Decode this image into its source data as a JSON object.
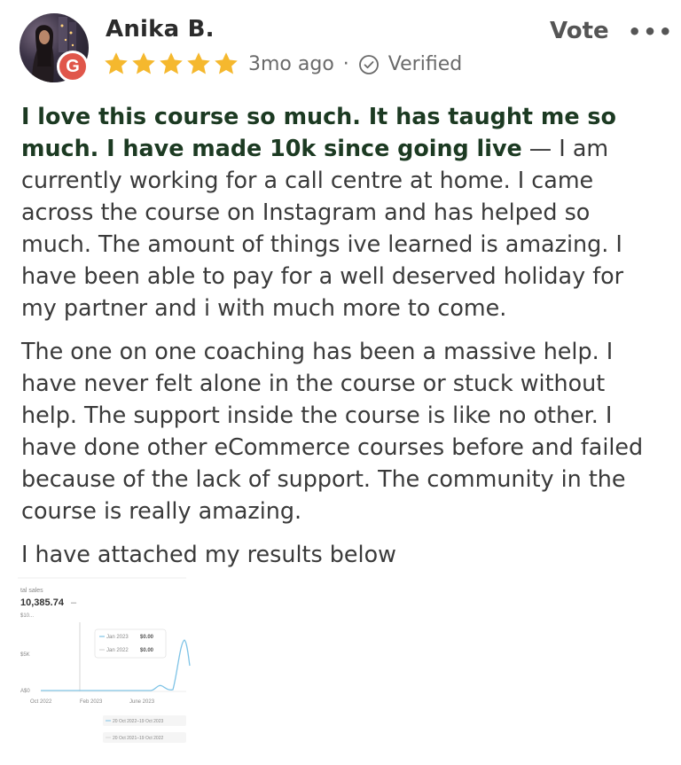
{
  "reviewer": {
    "name": "Anika B.",
    "rating": 5,
    "time_ago": "3mo ago",
    "separator": "·",
    "verified_label": "Verified",
    "source_badge_letter": "G"
  },
  "actions": {
    "vote_label": "Vote",
    "more_label": "•••"
  },
  "review": {
    "headline": "I love this course so much. It has taught me so much. I have made 10k since going live",
    "dash": " — ",
    "paragraph1_rest": "I am currently working for a call centre at home. I came across the course on Instagram and has helped so much. The amount of things ive learned is amazing. I have been able to pay for a well deserved holiday for my partner and i with much more to come.",
    "paragraph2": "The one on one coaching has been a massive help. I have never felt alone in the course or stuck without help. The support inside the course is like no other. I have done other eCommerce courses before and failed because of the lack of support. The community in the course is really amazing.",
    "paragraph3": "I have attached my results below"
  },
  "attachment": {
    "caption_label": "tal sales",
    "total": "10,385.74",
    "total_suffix": "–",
    "y_ticks": [
      "$10...",
      "$5K",
      "A$0"
    ],
    "x_ticks": [
      "Oct 2022",
      "Feb 2023",
      "June 2023"
    ],
    "tooltip": [
      {
        "label": "Jan 2023",
        "value": "$0.00"
      },
      {
        "label": "Jan 2022",
        "value": "$0.00"
      }
    ],
    "legend": [
      "20 Oct 2022–19 Oct 2023",
      "20 Oct 2021–19 Oct 2022"
    ],
    "colors": {
      "line": "#7ec3e6",
      "star": "#f5b82e",
      "badge": "#e0564a",
      "headline": "#1c3a22"
    }
  }
}
